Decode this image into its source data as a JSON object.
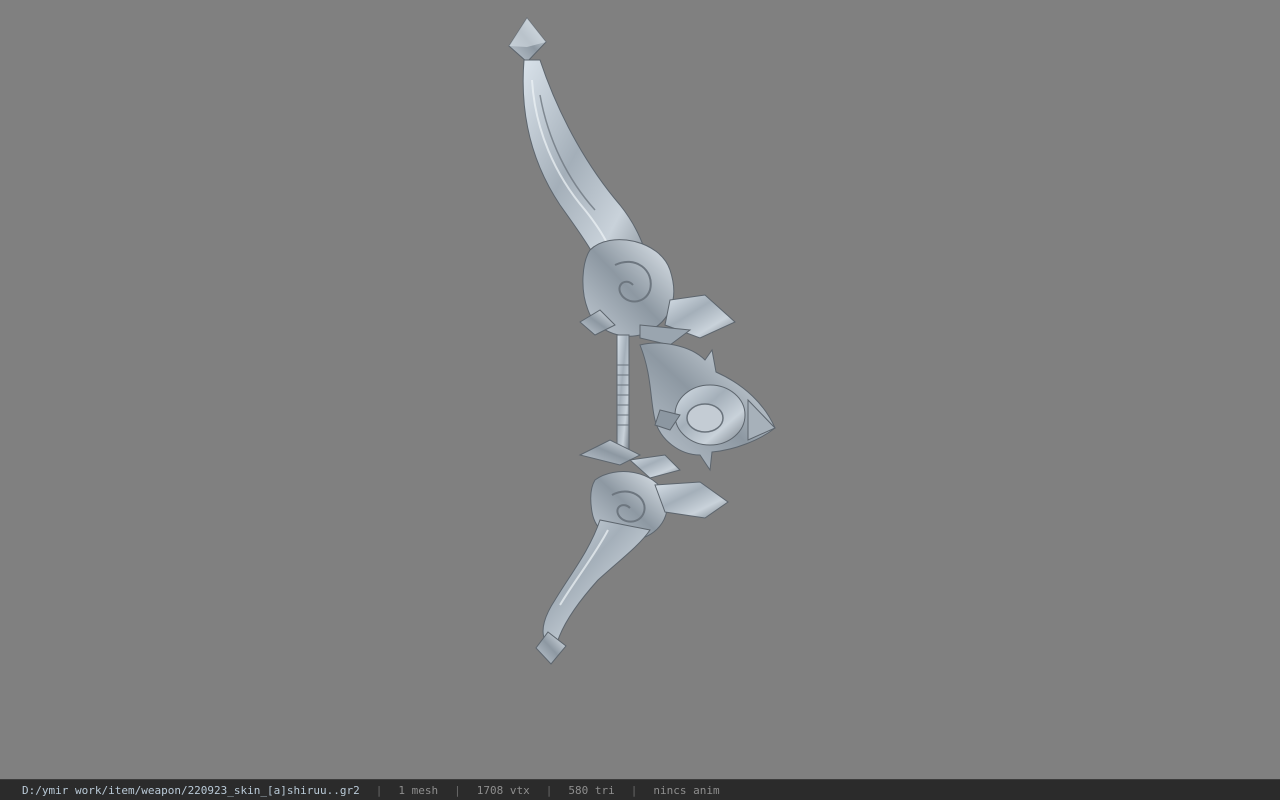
{
  "viewport": {
    "background": "#808080",
    "model_description_icon": "bow-model"
  },
  "statusbar": {
    "file_path": "D:/ymir work/item/weapon/220923_skin_[a]shiruu..gr2",
    "separator": "|",
    "mesh_count": "1 mesh",
    "vertex_count": "1708 vtx",
    "triangle_count": "580 tri",
    "animation": "nincs anim"
  }
}
